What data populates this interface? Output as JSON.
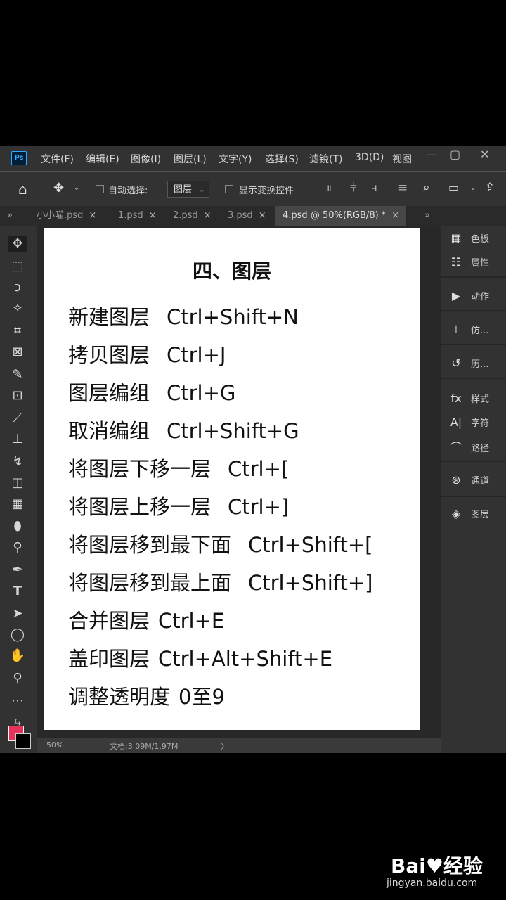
{
  "menubar": {
    "logo": "Ps",
    "items": [
      "文件(F)",
      "编辑(E)",
      "图像(I)",
      "图层(L)",
      "文字(Y)",
      "选择(S)",
      "滤镜(T)",
      "3D(D)",
      "视图"
    ],
    "minimize": "—",
    "maximize": "▢",
    "close": "✕"
  },
  "options": {
    "auto_select_label": "自动选择:",
    "auto_select_value": "图层",
    "show_transform_label": "显示变换控件"
  },
  "tabs": [
    {
      "label": "小小喵.psd",
      "active": false
    },
    {
      "label": "1.psd",
      "active": false
    },
    {
      "label": "2.psd",
      "active": false
    },
    {
      "label": "3.psd",
      "active": false
    },
    {
      "label": "4.psd @ 50%(RGB/8) *",
      "active": true
    }
  ],
  "tab_close": "×",
  "document": {
    "title": "四、图层",
    "lines": [
      {
        "name": "新建图层",
        "shortcut": "Ctrl+Shift+N"
      },
      {
        "name": "拷贝图层",
        "shortcut": "Ctrl+J"
      },
      {
        "name": "图层编组",
        "shortcut": "Ctrl+G"
      },
      {
        "name": "取消编组",
        "shortcut": "Ctrl+Shift+G"
      },
      {
        "name": "将图层下移一层",
        "shortcut": "Ctrl+["
      },
      {
        "name": "将图层上移一层",
        "shortcut": "Ctrl+]"
      },
      {
        "name": "将图层移到最下面",
        "shortcut": "Ctrl+Shift+["
      },
      {
        "name": "将图层移到最上面",
        "shortcut": "Ctrl+Shift+]"
      },
      {
        "name": "合并图层",
        "shortcut": "Ctrl+E"
      },
      {
        "name": "盖印图层",
        "shortcut": "Ctrl+Alt+Shift+E"
      },
      {
        "name": "调整透明度",
        "shortcut": "0至9"
      }
    ]
  },
  "status": {
    "zoom": "50%",
    "doc_size": "文档:3.09M/1.97M",
    "arrow": "〉"
  },
  "panels": [
    {
      "label": "色板",
      "icon": "swatches-icon"
    },
    {
      "label": "属性",
      "icon": "properties-icon"
    },
    {
      "label": "动作",
      "icon": "actions-icon"
    },
    {
      "label": "仿...",
      "icon": "clone-source-icon"
    },
    {
      "label": "历...",
      "icon": "history-icon"
    },
    {
      "label": "样式",
      "icon": "styles-icon"
    },
    {
      "label": "字符",
      "icon": "character-icon"
    },
    {
      "label": "路径",
      "icon": "paths-icon"
    },
    {
      "label": "通道",
      "icon": "channels-icon"
    },
    {
      "label": "图层",
      "icon": "layers-icon"
    }
  ],
  "watermark": {
    "logo": "Bai♥经验",
    "url": "jingyan.baidu.com"
  },
  "colors": {
    "foreground": "#e8325a",
    "background": "#000000"
  }
}
